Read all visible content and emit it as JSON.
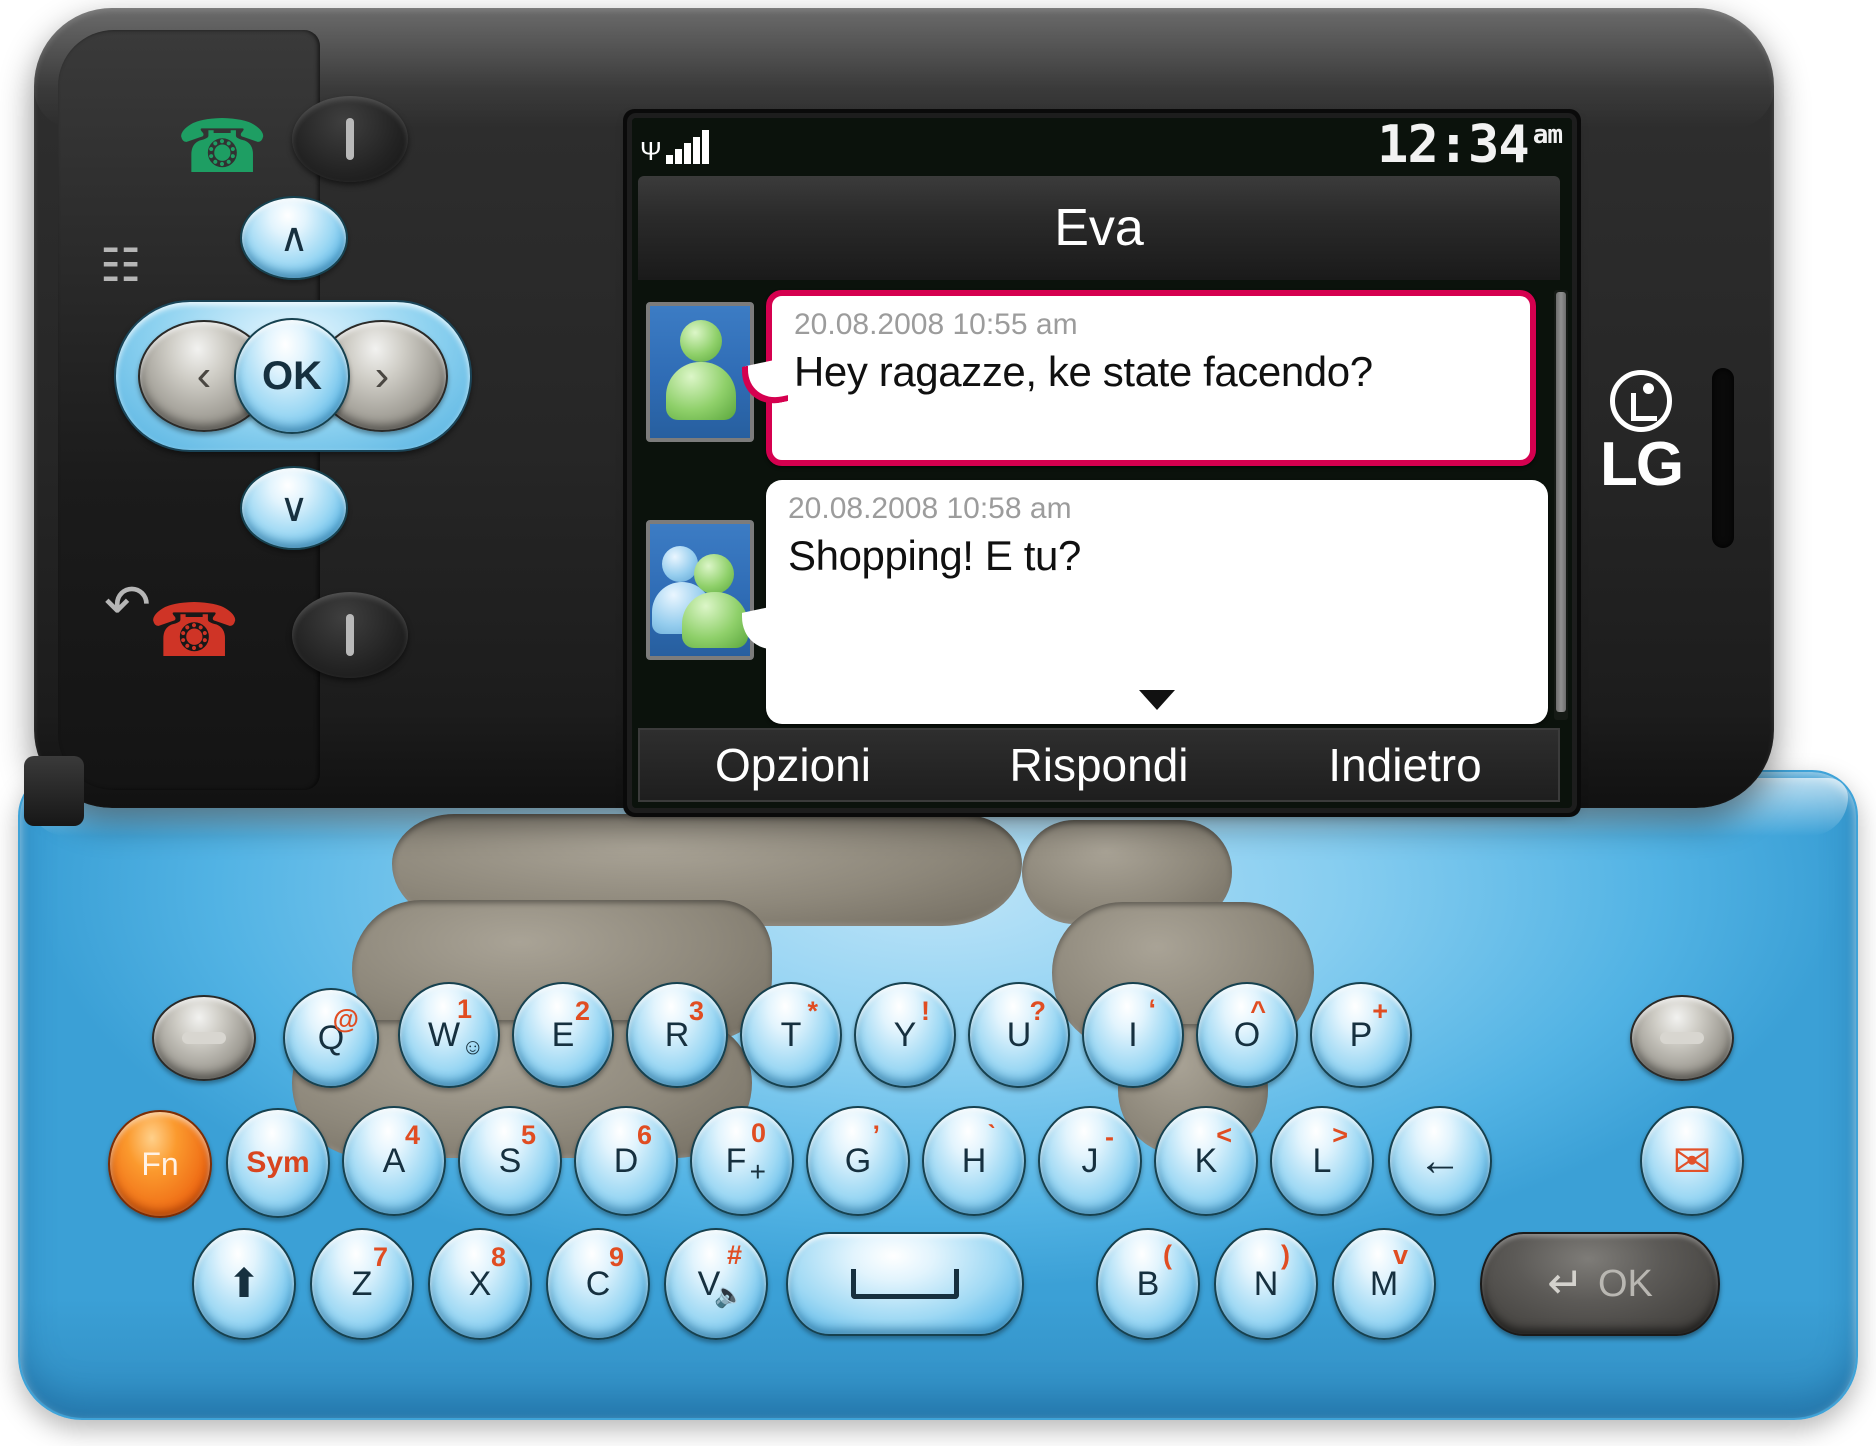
{
  "device": {
    "brand": "LG",
    "brand_mark": "lg-logo-icon",
    "body_color": "#262626",
    "keyboard_color": "#86cdf0",
    "accent_orange": "#ef6a14"
  },
  "screen": {
    "status": {
      "signal_icon": "signal-bars-icon",
      "signal_strength": 5,
      "time": "12:34",
      "ampm": "am"
    },
    "title": "Eva",
    "scrollbar": {
      "visible": true,
      "position": "top"
    },
    "messages": [
      {
        "avatar": "single-contact-avatar-icon",
        "timestamp": "20.08.2008 10:55 am",
        "text": "Hey ragazze, ke state facendo?",
        "highlighted": true,
        "highlight_color": "#d5004f"
      },
      {
        "avatar": "group-contact-avatar-icon",
        "timestamp": "20.08.2008 10:58 am",
        "text": "Shopping! E tu?",
        "highlighted": false,
        "more_indicator": "scroll-down-arrow-icon"
      }
    ],
    "softkeys": {
      "left": "Opzioni",
      "center": "Rispondi",
      "right": "Indietro"
    }
  },
  "navpad": {
    "up": "∧",
    "down": "∨",
    "left": "‹",
    "right": "›",
    "ok": "OK",
    "call_icon": "call-send-icon",
    "contacts_icon": "contacts-icon",
    "back_icon": "clear-back-icon",
    "end_icon": "call-end-icon",
    "softkey_left_icon": "soft-key-bar-icon",
    "softkey_right_icon": "soft-key-bar-icon"
  },
  "keyboard": {
    "row1": [
      {
        "main": "",
        "sup": "",
        "type": "grey",
        "icon": "left-soft-key"
      },
      {
        "main": "Q",
        "sup": "@",
        "type": "blue"
      },
      {
        "main": "W",
        "sup": "1",
        "type": "blue",
        "extra": "smiley"
      },
      {
        "main": "E",
        "sup": "2",
        "type": "blue"
      },
      {
        "main": "R",
        "sup": "3",
        "type": "blue"
      },
      {
        "main": "T",
        "sup": "*",
        "type": "blue"
      },
      {
        "main": "Y",
        "sup": "!",
        "type": "blue"
      },
      {
        "main": "U",
        "sup": "?",
        "type": "blue"
      },
      {
        "main": "I",
        "sup": "‘",
        "type": "blue"
      },
      {
        "main": "O",
        "sup": "^",
        "type": "blue"
      },
      {
        "main": "P",
        "sup": "+",
        "type": "blue"
      },
      {
        "main": "",
        "sup": "",
        "type": "grey",
        "icon": "right-soft-key"
      }
    ],
    "row2": [
      {
        "main": "Fn",
        "sup": "",
        "type": "orange"
      },
      {
        "main": "Sym",
        "sup": "",
        "type": "blue",
        "label_color": "#d9451f"
      },
      {
        "main": "A",
        "sup": "4",
        "type": "blue"
      },
      {
        "main": "S",
        "sup": "5",
        "type": "blue"
      },
      {
        "main": "D",
        "sup": "6",
        "type": "blue"
      },
      {
        "main": "F",
        "sup": "0",
        "type": "blue",
        "extra": "+"
      },
      {
        "main": "G",
        "sup": "’",
        "type": "blue"
      },
      {
        "main": "H",
        "sup": "ˋ",
        "type": "blue"
      },
      {
        "main": "J",
        "sup": "-",
        "type": "blue"
      },
      {
        "main": "K",
        "sup": "<",
        "type": "blue"
      },
      {
        "main": "L",
        "sup": ">",
        "type": "blue"
      },
      {
        "main": "←",
        "sup": "",
        "type": "blue",
        "icon": "backspace-icon"
      },
      {
        "main": "✉",
        "sup": "",
        "type": "blue",
        "icon": "message-envelope-icon"
      }
    ],
    "row3": [
      {
        "main": "⬆",
        "sup": "",
        "type": "blue",
        "icon": "shift-icon"
      },
      {
        "main": "Z",
        "sup": "7",
        "type": "blue"
      },
      {
        "main": "X",
        "sup": "8",
        "type": "blue"
      },
      {
        "main": "C",
        "sup": "9",
        "type": "blue"
      },
      {
        "main": "V",
        "sup": "#",
        "type": "blue",
        "extra": "mute"
      },
      {
        "main": "",
        "sup": "",
        "type": "blue",
        "icon": "space-bar-icon"
      },
      {
        "main": "B",
        "sup": "(",
        "type": "blue"
      },
      {
        "main": "N",
        "sup": ")",
        "type": "blue"
      },
      {
        "main": "M",
        "sup": "v",
        "type": "blue"
      },
      {
        "main": "OK",
        "sup": "",
        "type": "darkgrey",
        "icon": "enter-ok-key"
      }
    ]
  }
}
